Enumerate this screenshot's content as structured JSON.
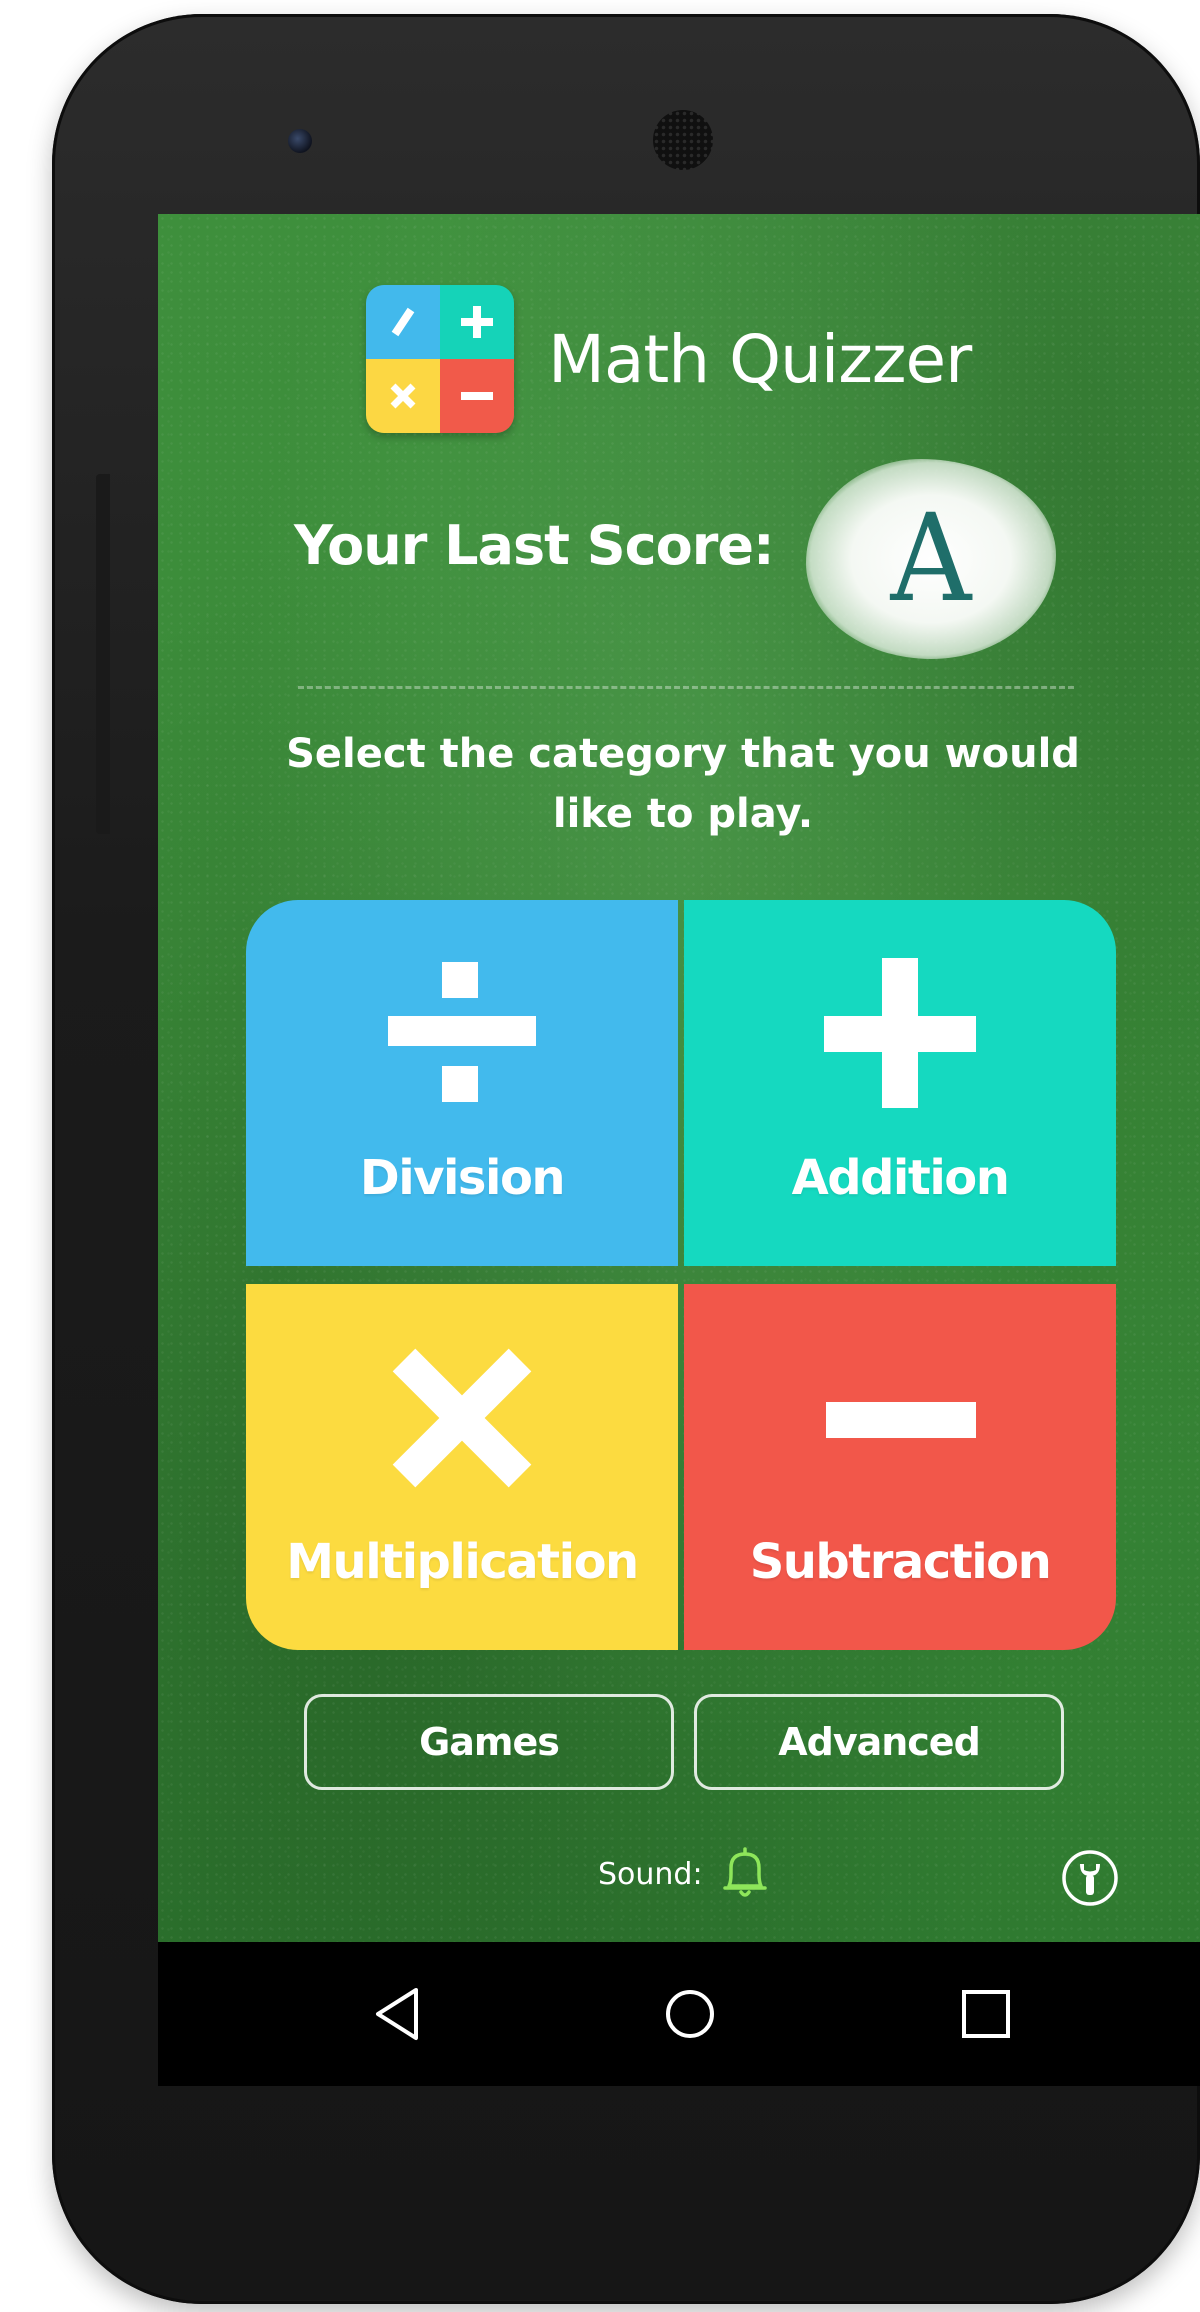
{
  "app": {
    "title": "Math Quizzer",
    "logo_symbols": [
      "/",
      "+",
      "×",
      "−"
    ]
  },
  "score": {
    "label": "Your Last Score:",
    "grade": "A"
  },
  "instructions": "Select the category that you would like to play.",
  "categories": [
    {
      "label": "Division",
      "symbol": "÷",
      "color": "#42baed"
    },
    {
      "label": "Addition",
      "symbol": "+",
      "color": "#15d9c0"
    },
    {
      "label": "Multiplication",
      "symbol": "×",
      "color": "#fcdb40"
    },
    {
      "label": "Subtraction",
      "symbol": "−",
      "color": "#f2574a"
    }
  ],
  "buttons": {
    "games": "Games",
    "advanced": "Advanced"
  },
  "footer": {
    "sound_label": "Sound:",
    "sound_icon": "bell-icon",
    "sound_icon_color": "#8ee65a",
    "settings_icon": "wrench-icon"
  },
  "navigation": {
    "back_icon": "back-triangle-icon",
    "home_icon": "home-circle-icon",
    "recents_icon": "recents-square-icon"
  },
  "colors": {
    "chalkboard": "#3a8a38",
    "score_grade": "#1f6e6a",
    "logo_blue": "#42b9ec",
    "logo_teal": "#15d3b8",
    "logo_yellow": "#fcd743",
    "logo_red": "#f15a4a"
  }
}
